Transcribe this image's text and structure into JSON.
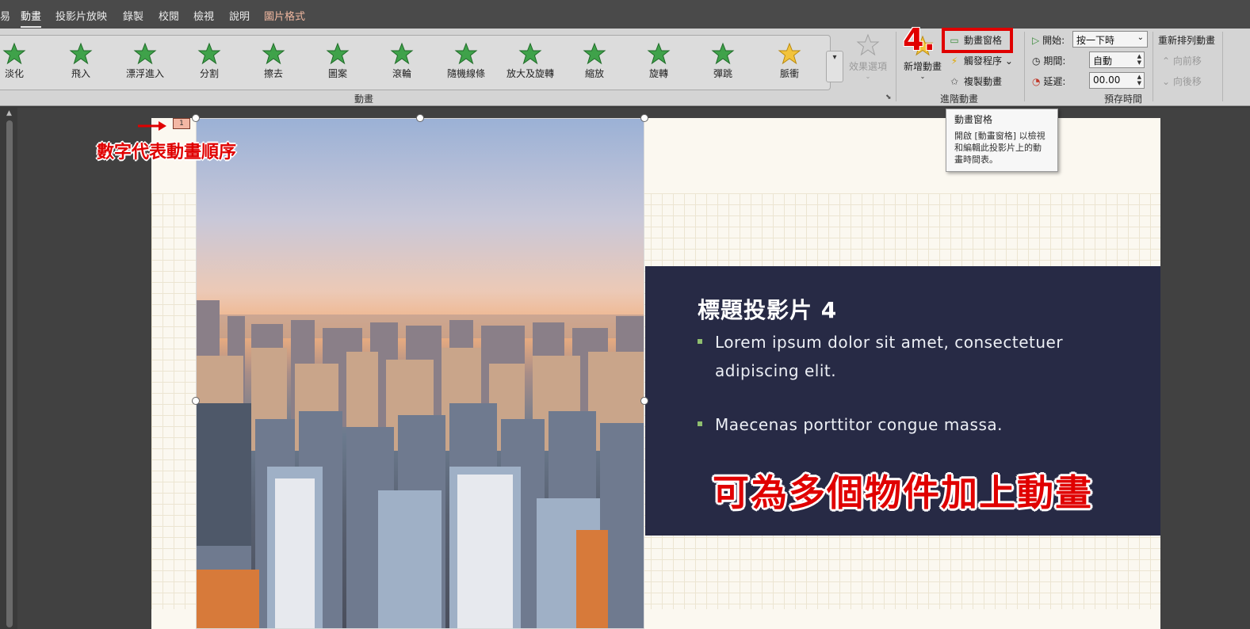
{
  "menu": {
    "items": [
      {
        "label": "易",
        "active": false
      },
      {
        "label": "動畫",
        "active": true
      },
      {
        "label": "投影片放映",
        "active": false
      },
      {
        "label": "錄製",
        "active": false
      },
      {
        "label": "校閱",
        "active": false
      },
      {
        "label": "檢視",
        "active": false
      },
      {
        "label": "說明",
        "active": false
      },
      {
        "label": "圖片格式",
        "active": false
      }
    ]
  },
  "ribbon": {
    "animations": [
      {
        "label": "淡化",
        "color": "#3fa24a"
      },
      {
        "label": "飛入",
        "color": "#3fa24a"
      },
      {
        "label": "漂浮進入",
        "color": "#3fa24a"
      },
      {
        "label": "分割",
        "color": "#3fa24a"
      },
      {
        "label": "擦去",
        "color": "#3fa24a"
      },
      {
        "label": "圖案",
        "color": "#3fa24a"
      },
      {
        "label": "滾輪",
        "color": "#3fa24a"
      },
      {
        "label": "隨機線條",
        "color": "#3fa24a"
      },
      {
        "label": "放大及旋轉",
        "color": "#3fa24a"
      },
      {
        "label": "縮放",
        "color": "#3fa24a"
      },
      {
        "label": "旋轉",
        "color": "#3fa24a"
      },
      {
        "label": "彈跳",
        "color": "#3fa24a"
      },
      {
        "label": "脈衝",
        "color": "#f2c33b"
      }
    ],
    "effect_options": "效果選項",
    "group_animation": "動畫",
    "add_animation": "新增動畫",
    "animation_pane": "動畫窗格",
    "trigger": "觸發程序",
    "animation_painter": "複製動畫",
    "group_advanced": "進階動畫",
    "start_label": "開始:",
    "start_value": "按一下時",
    "duration_label": "期間:",
    "duration_value": "自動",
    "delay_label": "延遲:",
    "delay_value": "00.00",
    "group_timing": "預存時間",
    "reorder_title": "重新排列動畫",
    "move_earlier": "向前移",
    "move_later": "向後移",
    "step_marker": "4."
  },
  "tooltip": {
    "title": "動畫窗格",
    "body": "開啟 [動畫窗格] 以檢視和編輯此投影片上的動畫時間表。"
  },
  "slide": {
    "title": "標題投影片 4",
    "bullets": [
      "Lorem ipsum dolor sit amet, consectetuer adipiscing elit.",
      "Maecenas porttitor congue massa."
    ],
    "anim_tag": "1",
    "order_note": "數字代表動畫順序",
    "caption": "可為多個物件加上動畫"
  },
  "colors": {
    "accent_red": "#e00000",
    "panel_navy": "#272a45",
    "bullet_green": "#8fbf6f"
  }
}
